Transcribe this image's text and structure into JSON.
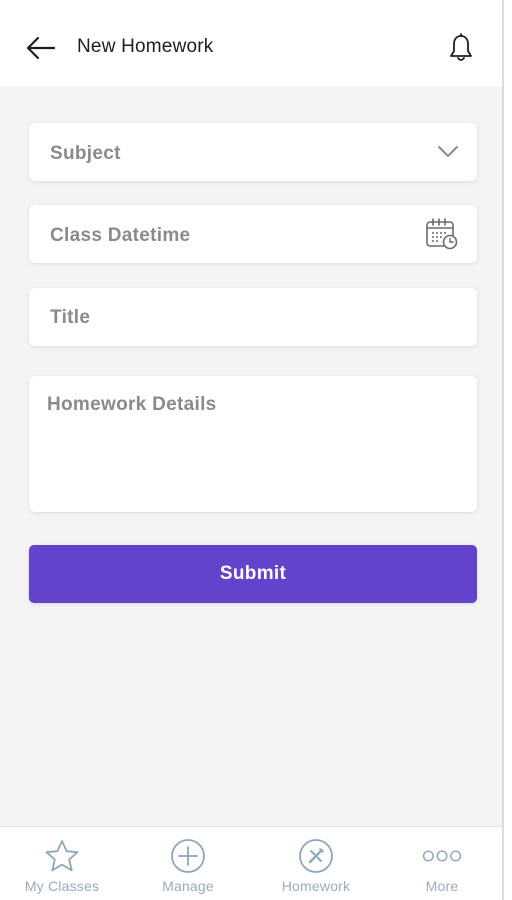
{
  "header": {
    "title": "New Homework",
    "back_icon": "arrow-left-icon",
    "bell_icon": "bell-icon"
  },
  "form": {
    "subject": {
      "placeholder": "Subject",
      "icon": "chevron-down-icon"
    },
    "class_datetime": {
      "placeholder": "Class Datetime",
      "icon": "calendar-clock-icon"
    },
    "title": {
      "placeholder": "Title"
    },
    "homework_details": {
      "placeholder": "Homework Details"
    },
    "submit_label": "Submit"
  },
  "bottom_nav": {
    "items": [
      {
        "label": "My Classes",
        "icon": "star-icon"
      },
      {
        "label": "Manage",
        "icon": "plus-circle-icon"
      },
      {
        "label": "Homework",
        "icon": "homework-icon"
      },
      {
        "label": "More",
        "icon": "more-dots-icon"
      }
    ]
  },
  "colors": {
    "accent": "#6443cc",
    "background": "#f4f4f5",
    "nav_icon": "#8fa6bb",
    "placeholder_text": "#8a8a8a"
  }
}
